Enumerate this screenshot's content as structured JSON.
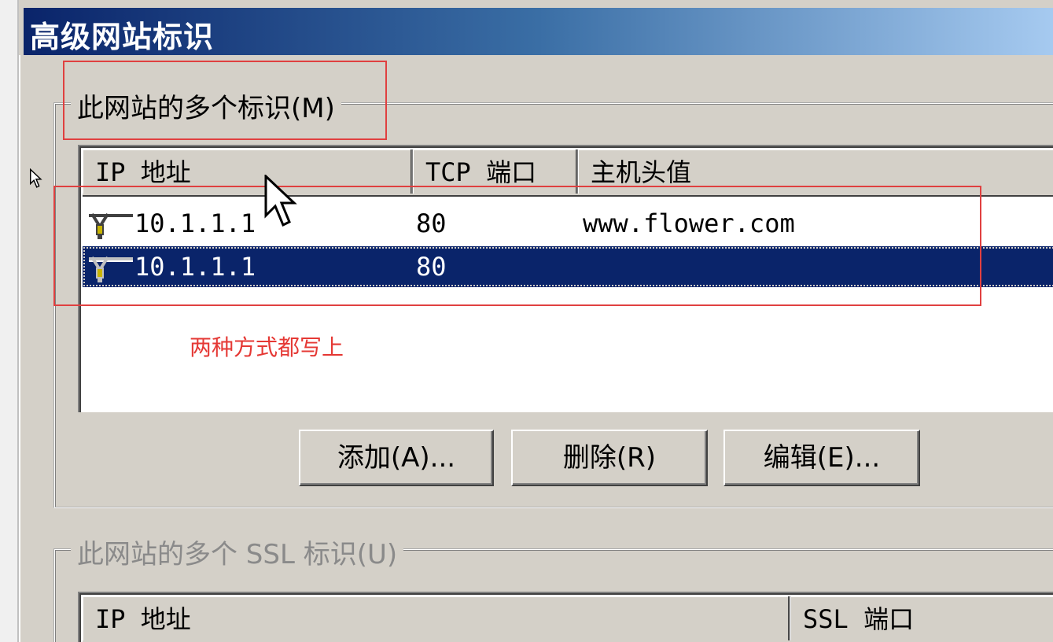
{
  "window": {
    "title": "高级网站标识"
  },
  "identities_group": {
    "legend": "此网站的多个标识(M)",
    "columns": [
      "IP 地址",
      "TCP 端口",
      "主机头值"
    ],
    "rows": [
      {
        "ip": "10.1.1.1",
        "port": "80",
        "host": "www.flower.com",
        "selected": false
      },
      {
        "ip": "10.1.1.1",
        "port": "80",
        "host": "",
        "selected": true
      }
    ],
    "buttons": {
      "add": "添加(A)...",
      "remove": "删除(R)",
      "edit": "编辑(E)..."
    }
  },
  "ssl_group": {
    "legend": "此网站的多个 SSL 标识(U)",
    "columns": [
      "IP 地址",
      "SSL 端口"
    ]
  },
  "annotation": {
    "note": "两种方式都写上",
    "color": "#e53935"
  },
  "icons": {
    "row_icon": "network-connector-icon",
    "cursor": "mouse-pointer-icon"
  },
  "colors": {
    "selection": "#0a246a",
    "titlebar_start": "#0a246a",
    "titlebar_end": "#a6caf0",
    "face": "#d4d0c8"
  }
}
